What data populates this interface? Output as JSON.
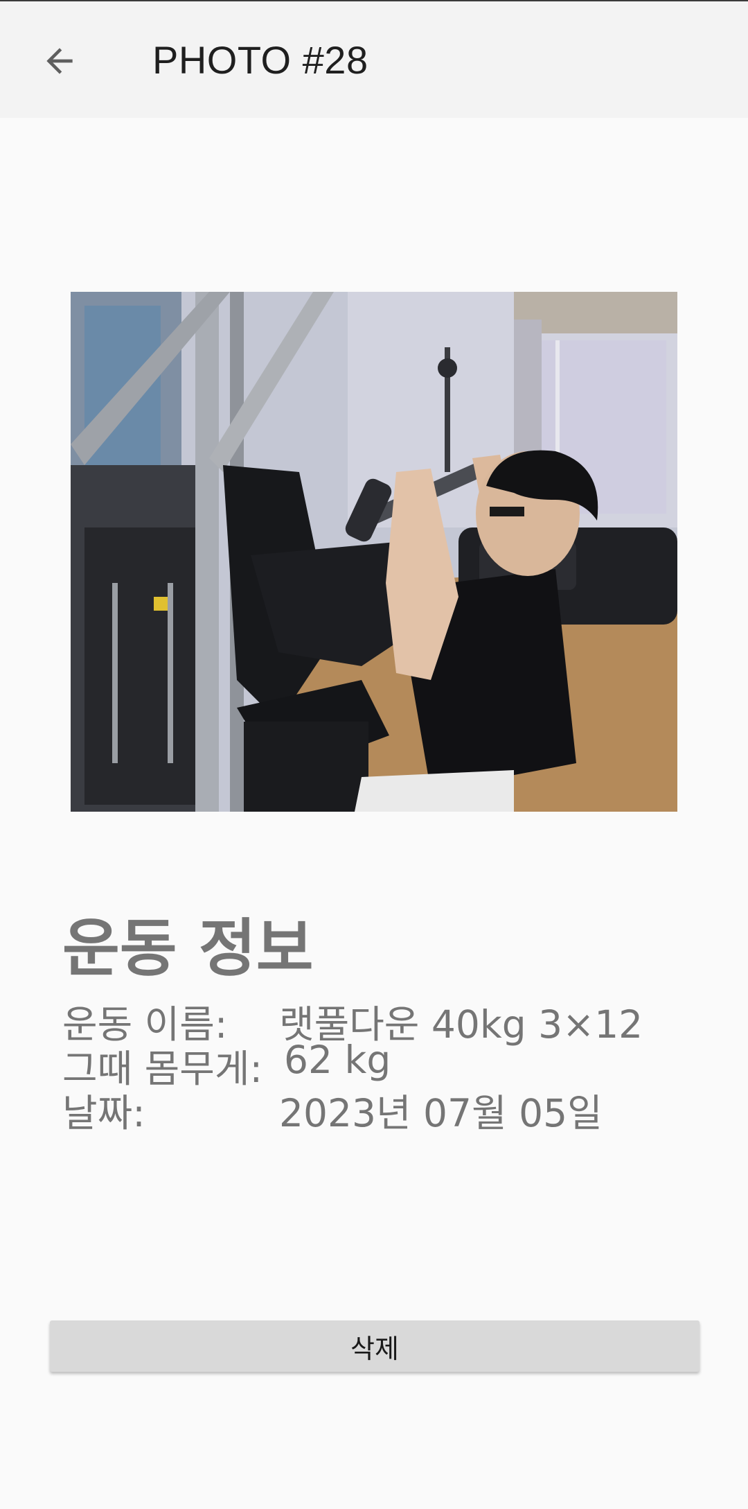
{
  "header": {
    "title": "PHOTO #28",
    "back_icon": "arrow-left-icon"
  },
  "photo": {
    "description_icon": "workout-photo"
  },
  "info": {
    "section_title": "운동 정보",
    "exercise_label": "운동 이름:",
    "exercise_value": "랫풀다운 40kg 3×12",
    "weight_label": "그때 몸무게:",
    "weight_value": "62 kg",
    "date_label": "날짜:",
    "date_value": "2023년 07월 05일"
  },
  "actions": {
    "delete_label": "삭제"
  },
  "colors": {
    "app_bar": "#f3f3f3",
    "background": "#fafafa",
    "info_text": "#757575",
    "delete_button": "#d9d9d9"
  }
}
